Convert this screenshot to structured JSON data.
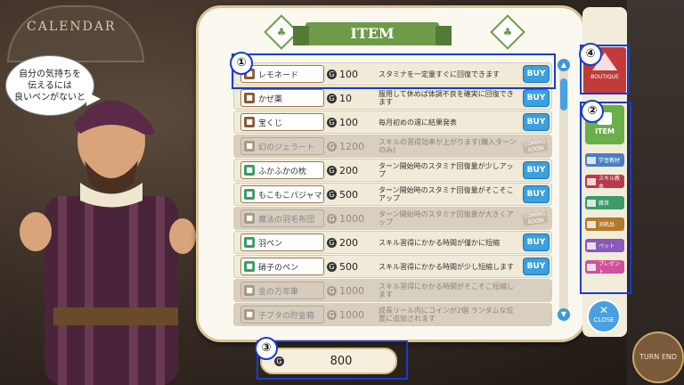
{
  "background": {
    "calendar_label": "CALENDAR",
    "turn_end_label": "TURN END"
  },
  "speech_bubble": {
    "text": "自分の気持ちを\n伝えるには\n良いペンがないと"
  },
  "panel": {
    "title": "ITEM",
    "items": [
      {
        "name": "レモネード",
        "price": "100",
        "desc": "スタミナを一定量すぐに回復できます",
        "action": "BUY",
        "available": true,
        "icon": "cup-icon"
      },
      {
        "name": "かぜ薬",
        "price": "10",
        "desc": "服用して休めば体調不良を確実に回復できます",
        "action": "BUY",
        "available": true,
        "icon": "medicine-icon"
      },
      {
        "name": "宝くじ",
        "price": "100",
        "desc": "毎月初めの週に結果発表",
        "action": "BUY",
        "available": true,
        "icon": "ticket-icon"
      },
      {
        "name": "幻のジェラート",
        "price": "1200",
        "desc": "スキルの習得効率が上がります(購入ターンのみ)",
        "action": "COMING SOON",
        "available": false,
        "icon": "gelato-icon"
      },
      {
        "name": "ふかふかの枕",
        "price": "200",
        "desc": "ターン開始時のスタミナ回復量が少しアップ",
        "action": "BUY",
        "available": true,
        "icon": "pillow-icon"
      },
      {
        "name": "もこもこパジャマ",
        "price": "500",
        "desc": "ターン開始時のスタミナ回復量がそこそこアップ",
        "action": "BUY",
        "available": true,
        "icon": "pajama-icon"
      },
      {
        "name": "魔法の羽毛布団",
        "price": "1000",
        "desc": "ターン開始時のスタミナ回復量が大きくアップ",
        "action": "COMING SOON",
        "available": false,
        "icon": "futon-icon"
      },
      {
        "name": "羽ペン",
        "price": "200",
        "desc": "スキル習得にかかる時間が僅かに短縮",
        "action": "BUY",
        "available": true,
        "icon": "quill-icon"
      },
      {
        "name": "硝子のペン",
        "price": "500",
        "desc": "スキル習得にかかる時間が少し短縮します",
        "action": "BUY",
        "available": true,
        "icon": "glass-pen-icon"
      },
      {
        "name": "金の万年筆",
        "price": "1000",
        "desc": "スキル習得にかかる時間がそこそこ短縮します",
        "action": "",
        "available": false,
        "icon": "fountain-pen-icon"
      },
      {
        "name": "子ブタの貯金箱",
        "price": "1000",
        "desc": "成長リール内にコインが2個 ランダムな位置に追加されます",
        "action": "",
        "available": false,
        "icon": "piggy-bank-icon"
      }
    ]
  },
  "side": {
    "boutique_label": "BOUTIQUE",
    "item_tab_label": "ITEM",
    "categories": [
      {
        "label": "学習教材",
        "color": "#4a7fc0"
      },
      {
        "label": "スキル教本",
        "color": "#b83a4a"
      },
      {
        "label": "雑貨",
        "color": "#3a9a6a"
      },
      {
        "label": "消耗品",
        "color": "#b07a2a"
      },
      {
        "label": "ペット",
        "color": "#8a5ab8"
      },
      {
        "label": "プレゼント",
        "color": "#d0509a"
      }
    ],
    "close_label": "CLOSE"
  },
  "currency": {
    "amount": "800"
  },
  "annotations": [
    "①",
    "②",
    "③",
    "④"
  ]
}
